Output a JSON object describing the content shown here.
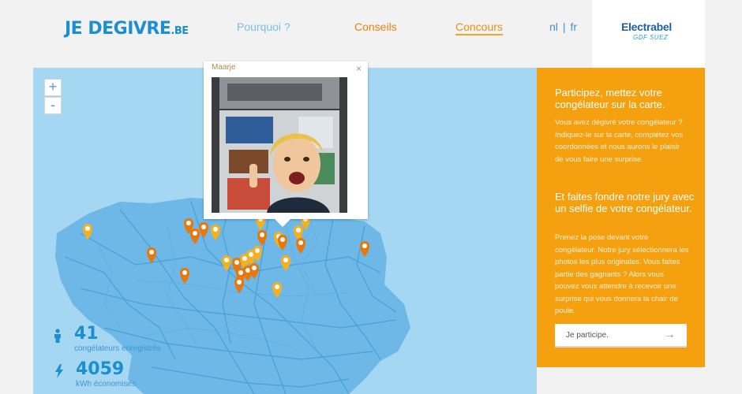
{
  "header": {
    "logo_main": "JE DEGIVRE",
    "logo_suffix": ".BE",
    "nav": [
      {
        "label": "Pourquoi ?"
      },
      {
        "label": "Conseils"
      },
      {
        "label": "Concours"
      }
    ],
    "lang_nl": "nl",
    "lang_sep": "|",
    "lang_fr": "fr",
    "brand": "Electrabel",
    "brand_sub": "GDF SUEZ"
  },
  "map": {
    "zoom_in": "+",
    "zoom_out": "-",
    "colors": {
      "water": "#a5d6f2",
      "land": "#6db8e6",
      "roads": "#4b9fd4",
      "pin_orange": "#e8780c",
      "pin_yellow": "#f5b020"
    }
  },
  "popup": {
    "name": "Maarje",
    "close": "×"
  },
  "stats": {
    "registered_count": "41",
    "registered_label": "congélateurs enregistrés",
    "kwh_count": "4059",
    "kwh_label": "kWh économisés"
  },
  "sidebar": {
    "heading1": "Participez, mettez votre congélateur sur la carte.",
    "text1": "Vous avez dégivré votre congélateur ? Indiquez-le sur la carte, complétez vos coordonnées et nous aurons le plaisir de vous faire une surprise.",
    "heading2": "Et faites fondre notre jury avec un selfie de votre congélateur.",
    "text2": "Prenez la pose devant votre congélateur. Notre jury sélectionnera les photos les plus originales. Vous faites partie des gagnants ? Alors vous pouvez vous attendre à recevoir une surprise qui vous donnera la chair de poule.",
    "button_label": "Je participe.",
    "button_arrow": "→"
  }
}
